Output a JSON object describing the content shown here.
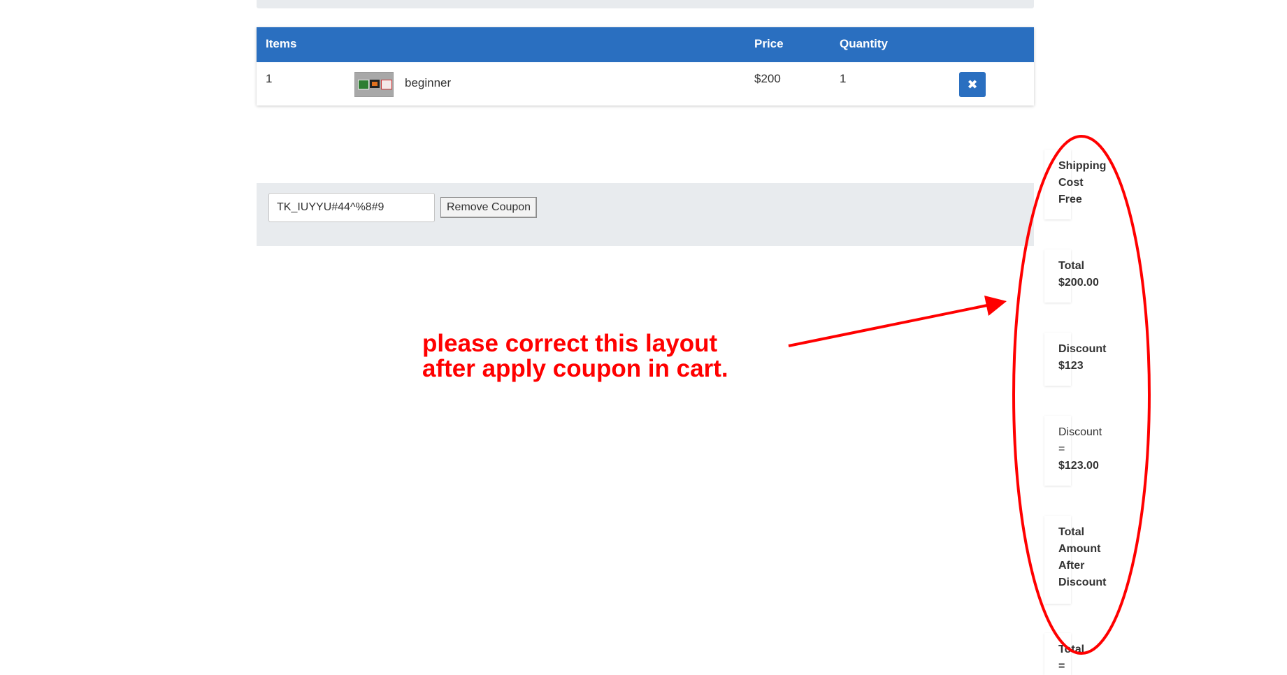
{
  "cart": {
    "headers": {
      "items": "Items",
      "price": "Price",
      "quantity": "Quantity"
    },
    "row": {
      "index": "1",
      "name": "beginner",
      "price": "$200",
      "quantity": "1",
      "remove_icon": "✖"
    }
  },
  "coupon": {
    "code": "TK_IUYYU#44^%8#9",
    "remove_label": "Remove Coupon"
  },
  "summary": [
    {
      "label": "Shipping\nCost",
      "value": "Free"
    },
    {
      "label": "Total",
      "value": "$200.00"
    },
    {
      "label": "Discount",
      "value": "$123"
    },
    {
      "label": "Discount\n=",
      "value": "$123.00"
    },
    {
      "label": "Total\nAmount\nAfter\nDiscount",
      "value": ""
    },
    {
      "label": "Total\n=",
      "value": ""
    }
  ],
  "annotation": {
    "text": "please correct this layout\nafter apply coupon in cart.",
    "color": "#ff0000"
  },
  "colors": {
    "accent": "#2a6fc0",
    "panel": "#e8ebee",
    "annotation": "#ff0000"
  }
}
